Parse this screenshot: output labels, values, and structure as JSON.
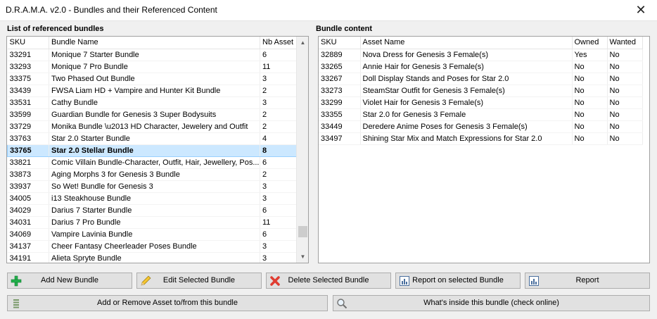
{
  "window": {
    "title": "D.R.A.M.A. v2.0 - Bundles and their Referenced Content",
    "close": "✕"
  },
  "left": {
    "heading": "List of referenced bundles",
    "columns": [
      "SKU",
      "Bundle Name",
      "Nb Asset"
    ],
    "selected_sku": "33765",
    "rows": [
      {
        "sku": "33291",
        "name": "Monique 7 Starter Bundle",
        "nb": "6"
      },
      {
        "sku": "33293",
        "name": "Monique 7 Pro Bundle",
        "nb": "11"
      },
      {
        "sku": "33375",
        "name": "Two Phased Out Bundle",
        "nb": "3"
      },
      {
        "sku": "33439",
        "name": "FWSA Liam HD + Vampire and Hunter Kit Bundle",
        "nb": "2"
      },
      {
        "sku": "33531",
        "name": "Cathy Bundle",
        "nb": "3"
      },
      {
        "sku": "33599",
        "name": "Guardian Bundle for Genesis 3 Super Bodysuits",
        "nb": "2"
      },
      {
        "sku": "33729",
        "name": "Monika Bundle \\u2013 HD Character, Jewelery and Outfit",
        "nb": "2"
      },
      {
        "sku": "33763",
        "name": "Star 2.0 Starter Bundle",
        "nb": "4"
      },
      {
        "sku": "33765",
        "name": "Star 2.0 Stellar Bundle",
        "nb": "8"
      },
      {
        "sku": "33821",
        "name": "Comic Villain Bundle-Character, Outfit, Hair, Jewellery, Pos...",
        "nb": "6"
      },
      {
        "sku": "33873",
        "name": "Aging Morphs 3 for Genesis 3 Bundle",
        "nb": "2"
      },
      {
        "sku": "33937",
        "name": "So Wet! Bundle for Genesis 3",
        "nb": "3"
      },
      {
        "sku": "34005",
        "name": "i13 Steakhouse Bundle",
        "nb": "3"
      },
      {
        "sku": "34029",
        "name": "Darius 7 Starter Bundle",
        "nb": "6"
      },
      {
        "sku": "34031",
        "name": "Darius 7 Pro Bundle",
        "nb": "11"
      },
      {
        "sku": "34069",
        "name": "Vampire Lavinia Bundle",
        "nb": "6"
      },
      {
        "sku": "34137",
        "name": "Cheer Fantasy Cheerleader Poses Bundle",
        "nb": "3"
      },
      {
        "sku": "34191",
        "name": "Alieta Spryte Bundle",
        "nb": "3"
      }
    ],
    "scroll": {
      "up": "▲",
      "down": "▼",
      "position": 0.93
    }
  },
  "right": {
    "heading": "Bundle content",
    "columns": [
      "SKU",
      "Asset Name",
      "Owned",
      "Wanted"
    ],
    "rows": [
      {
        "sku": "32889",
        "name": "Nova Dress for Genesis 3 Female(s)",
        "owned": "Yes",
        "wanted": "No"
      },
      {
        "sku": "33265",
        "name": "Annie Hair for Genesis 3 Female(s)",
        "owned": "No",
        "wanted": "No"
      },
      {
        "sku": "33267",
        "name": "Doll Display Stands and Poses for Star 2.0",
        "owned": "No",
        "wanted": "No"
      },
      {
        "sku": "33273",
        "name": "SteamStar Outfit for Genesis 3 Female(s)",
        "owned": "No",
        "wanted": "No"
      },
      {
        "sku": "33299",
        "name": "Violet Hair for Genesis 3 Female(s)",
        "owned": "No",
        "wanted": "No"
      },
      {
        "sku": "33355",
        "name": "Star 2.0 for Genesis 3 Female",
        "owned": "No",
        "wanted": "No"
      },
      {
        "sku": "33449",
        "name": "Deredere Anime Poses for Genesis 3 Female(s)",
        "owned": "No",
        "wanted": "No"
      },
      {
        "sku": "33497",
        "name": "Shining Star Mix and Match Expressions for Star 2.0",
        "owned": "No",
        "wanted": "No"
      }
    ]
  },
  "buttons": {
    "add_new": {
      "label": "Add New Bundle",
      "icon": "plus-icon"
    },
    "edit": {
      "label": "Edit Selected Bundle",
      "icon": "pencil-icon"
    },
    "delete": {
      "label": "Delete Selected Bundle",
      "icon": "red-x-icon"
    },
    "report_selected": {
      "label": "Report on selected Bundle",
      "icon": "report-icon"
    },
    "report": {
      "label": "Report",
      "icon": "report-icon"
    },
    "add_remove": {
      "label": "Add or Remove Asset to/from this bundle",
      "icon": "list-icon"
    },
    "whats_inside": {
      "label": "What's inside this bundle (check online)",
      "icon": "magnifier-icon"
    }
  },
  "colors": {
    "selection": "#cce8ff",
    "plus": "#22b14c",
    "delete": "#e03c31"
  }
}
